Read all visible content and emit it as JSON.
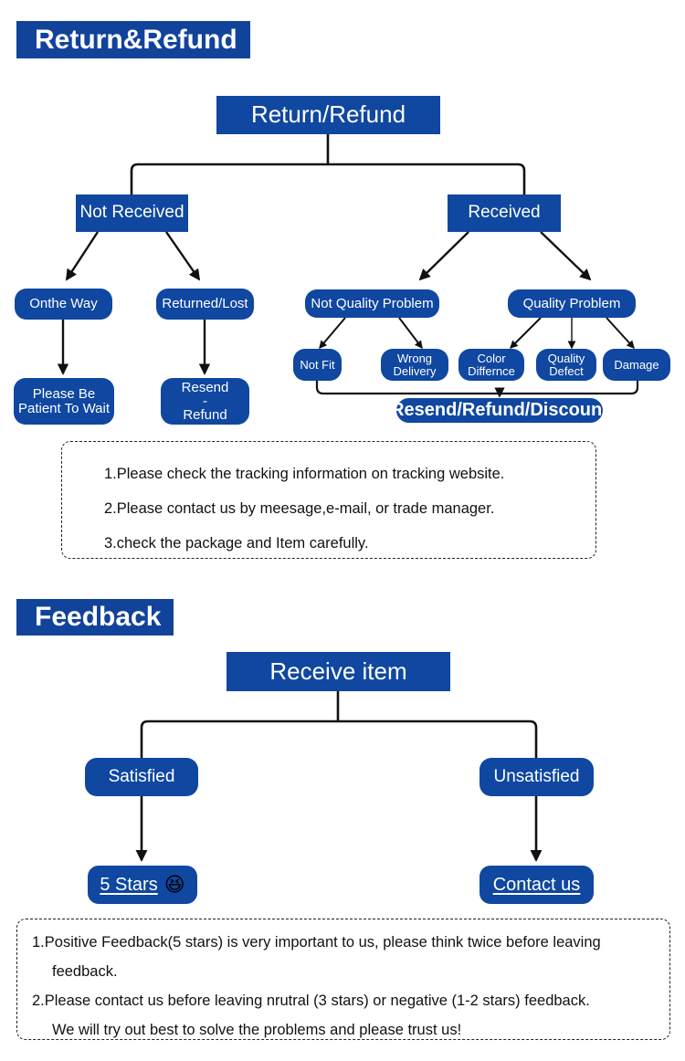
{
  "sections": [
    {
      "id": "return_refund",
      "title": "Return&Refund"
    },
    {
      "id": "feedback",
      "title": "Feedback"
    }
  ],
  "return_flow": {
    "root": "Return/Refund",
    "branch_left": "Not Received",
    "branch_right": "Received",
    "not_received_children": [
      "Onthe Way",
      "Returned/Lost"
    ],
    "onthe_way_result": "Please Be\nPatient To Wait",
    "onthe_way_result_lines": [
      "Please Be",
      "Patient To Wait"
    ],
    "returned_lost_result_lines": [
      "Resend",
      "-",
      "Refund"
    ],
    "received_children": [
      "Not Quality Problem",
      "Quality Problem"
    ],
    "not_quality_children": [
      {
        "lines": [
          "Not Fit"
        ]
      },
      {
        "lines": [
          "Wrong",
          "Delivery"
        ]
      }
    ],
    "quality_children": [
      {
        "lines": [
          "Color",
          "Differnce"
        ]
      },
      {
        "lines": [
          "Quality",
          "Defect"
        ]
      },
      {
        "lines": [
          "Damage"
        ]
      }
    ],
    "resolution": "Resend/Refund/Discount"
  },
  "return_notes": [
    "1.Please check the tracking information on tracking website.",
    "2.Please contact us by meesage,e-mail, or trade manager.",
    "3.check the package and Item carefully."
  ],
  "feedback_flow": {
    "root": "Receive item",
    "branch_left": "Satisfied",
    "branch_right": "Unsatisfied",
    "satisfied_action": "5 Stars",
    "satisfied_emoji": "😆",
    "unsatisfied_action": "Contact us"
  },
  "feedback_notes": [
    "1.Positive Feedback(5 stars) is very important to us, please think twice before leaving",
    "feedback.",
    "2.Please contact us before leaving nrutral (3 stars) or  negative (1-2 stars) feedback.",
    "We will try out best to solve the problems and please trust us!"
  ],
  "colors": {
    "brand_blue": "#12439b",
    "node_blue": "#0f47a1",
    "text_white": "#ffffff",
    "line_black": "#111111",
    "emoji_yellow": "#f7c948"
  }
}
